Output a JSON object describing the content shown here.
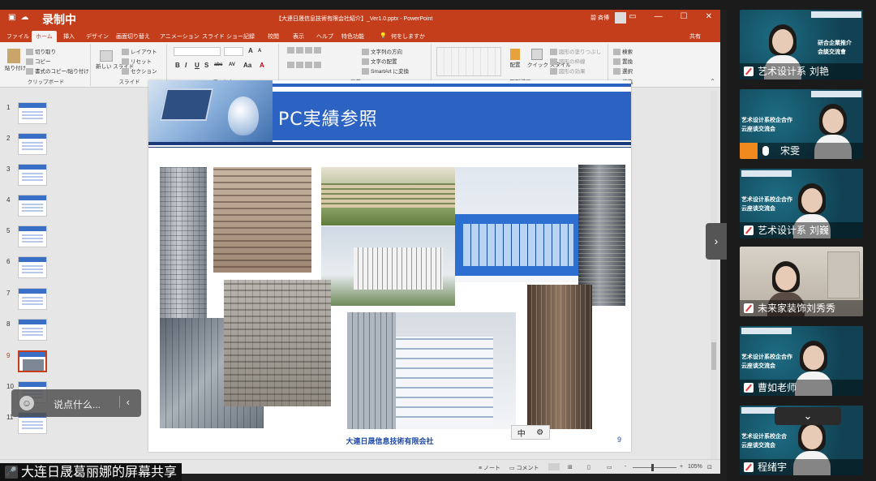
{
  "recording": "录制中",
  "doc_title": "【大連日晟信息技術有限会社紹介】_Ver1.0.pptx - PowerPoint",
  "user": "碧 斉博",
  "tabs": [
    "ファイル",
    "ホーム",
    "挿入",
    "デザイン",
    "画面切り替え",
    "アニメーション",
    "スライド ショー",
    "記録",
    "校閲",
    "表示",
    "ヘルプ",
    "特色功能",
    "何をしますか"
  ],
  "share": "共有",
  "ribbon": {
    "clipboard": {
      "paste": "貼り付け",
      "cut": "切り取り",
      "copy": "コピー",
      "format_painter": "書式のコピー/貼り付け",
      "label": "クリップボード"
    },
    "slides": {
      "new": "新しい\nスライド",
      "layout": "レイアウト",
      "reset": "リセット",
      "section": "セクション",
      "label": "スライド"
    },
    "font": {
      "label": "フォント",
      "bold": "B",
      "italic": "I",
      "underline": "U",
      "shadow": "S",
      "strike": "abc",
      "spacing": "AV",
      "case": "Aa",
      "color": "A"
    },
    "paragraph": {
      "label": "段落",
      "text_dir": "文字列の方向",
      "align_text": "文字の配置",
      "smartart": "SmartArt に変換"
    },
    "drawing": {
      "label": "図形描画",
      "arrange": "配置",
      "quick_styles": "クイック\nスタイル",
      "fill": "図形の塗りつぶし",
      "outline": "図形の枠線",
      "effects": "図形の効果"
    },
    "editing": {
      "label": "編集",
      "find": "検索",
      "replace": "置換",
      "select": "選択"
    }
  },
  "thumbnails": [
    "1",
    "2",
    "3",
    "4",
    "5",
    "6",
    "7",
    "8",
    "9",
    "10",
    "11"
  ],
  "selected_slide": "9",
  "slide": {
    "title": "PC実績参照",
    "footer": "大連日晟信息技術有限会社",
    "page": "9"
  },
  "ime": {
    "mode": "中",
    "gear": "⚙"
  },
  "status": {
    "notes": "ノート",
    "comments": "コメント",
    "zoom": "105%",
    "minus": "-",
    "plus": "+"
  },
  "chat_placeholder": "说点什么...",
  "share_label": "大连日晟葛丽娜的屏幕共享",
  "participants": [
    {
      "name": "艺术设计系 刘艳",
      "banner": [
        "研合企業推介",
        "会談交流會"
      ]
    },
    {
      "name": "宋雯",
      "banner": [
        "艺术设计系校企合作",
        "云座谈交流会"
      ]
    },
    {
      "name": "艺术设计系 刘巍",
      "banner": [
        "艺术设计系校企合作",
        "云座谈交流会"
      ]
    },
    {
      "name": "未来家装饰刘秀秀",
      "banner": []
    },
    {
      "name": "曹如老师",
      "banner": [
        "艺术设计系校企合作",
        "云座谈交流会"
      ]
    },
    {
      "name": "程绪宇",
      "banner": [
        "艺术设计系校企合",
        "云座谈交流会"
      ]
    }
  ],
  "colors": {
    "ppt_accent": "#c43e1c",
    "slide_blue": "#2c63c3",
    "footer_blue": "#1f4aa8"
  }
}
